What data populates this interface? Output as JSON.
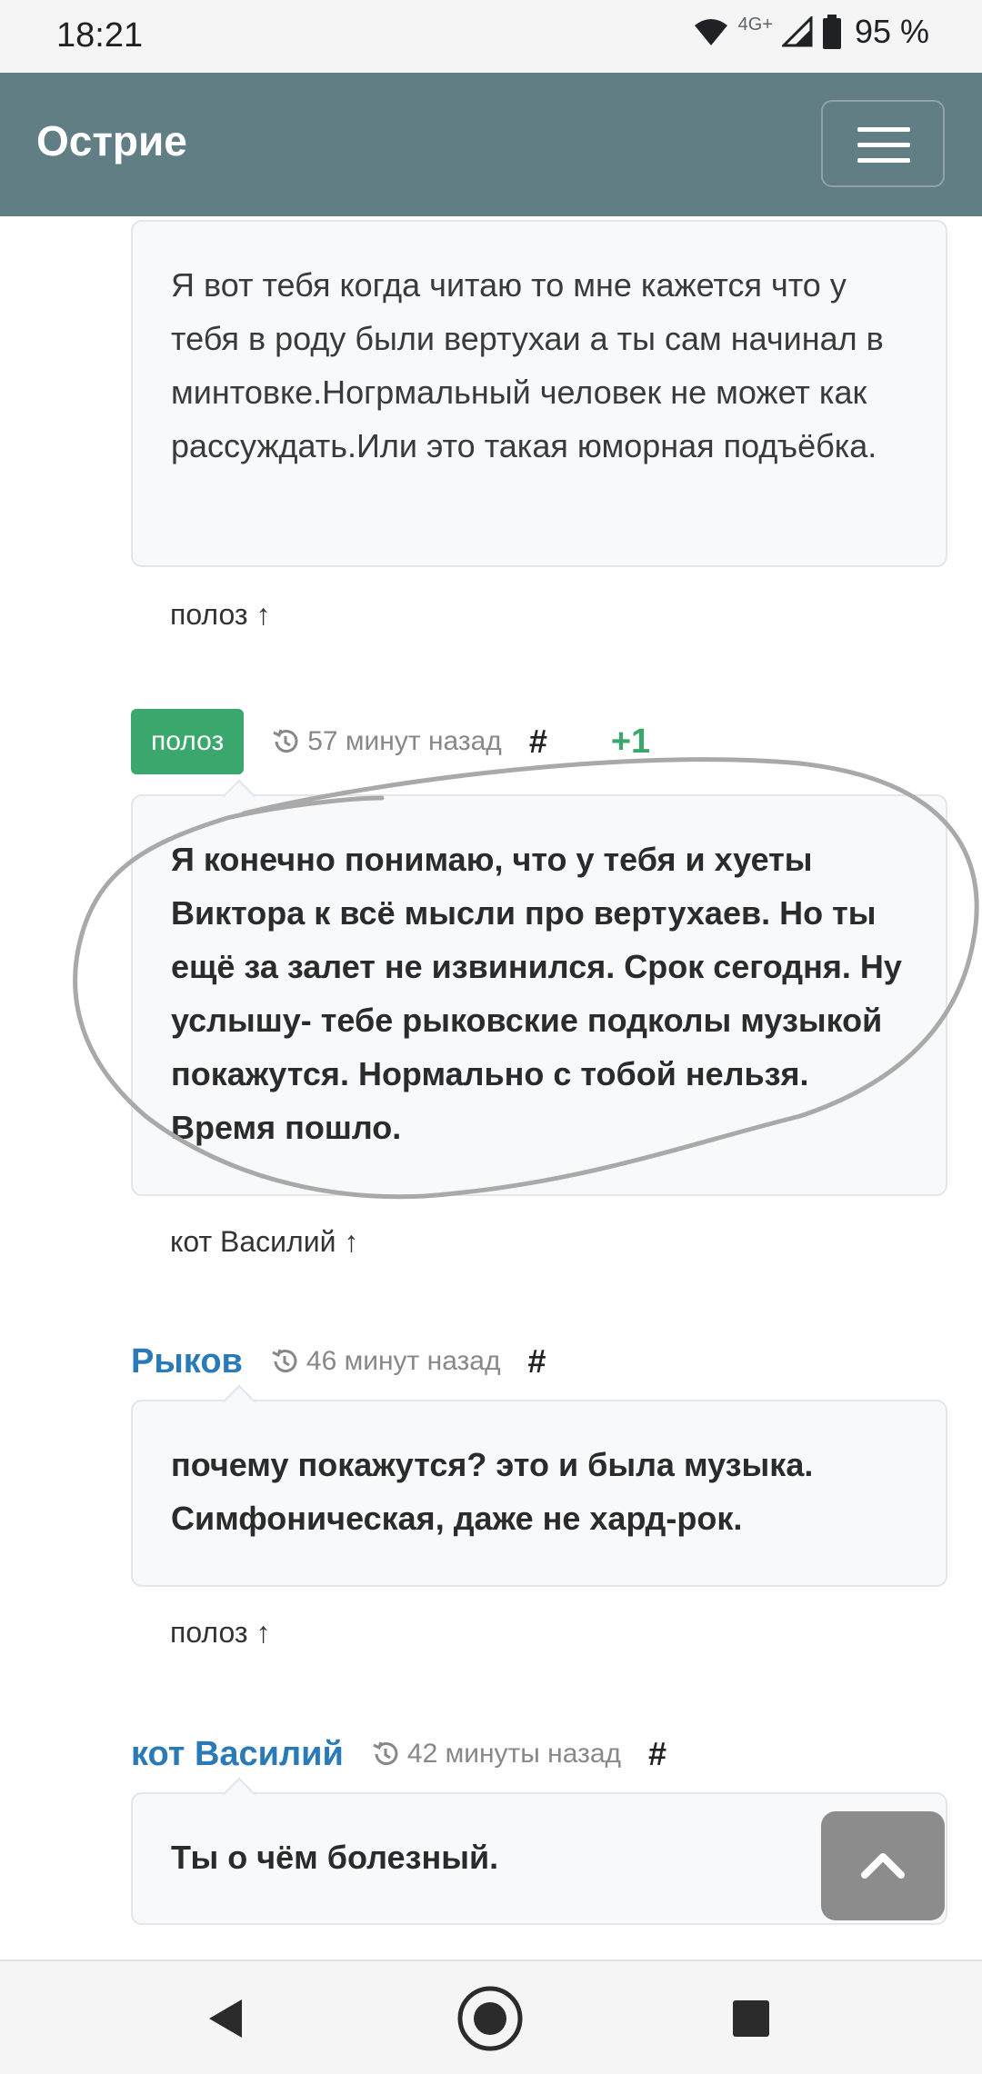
{
  "status": {
    "time": "18:21",
    "network": "4G+",
    "battery": "95 %",
    "icons": [
      "wifi-icon",
      "signal-icon",
      "battery-icon"
    ]
  },
  "navbar": {
    "brand": "Острие",
    "toggler_icon": "hamburger-icon"
  },
  "comments": [
    {
      "text": "Я вот тебя когда читаю то мне кажется что у тебя в роду были вертухаи а ты сам начинал в минтовке.Ногрмальный человек не может как рассуждать.Или это такая юморная подъёбка.",
      "reply_to": "полоз ↑"
    },
    {
      "author": "полоз",
      "time": "57 минут назад",
      "hash": "#",
      "votes": "+1",
      "text": "Я конечно понимаю, что у тебя и хуеты Виктора к всё мысли про вертухаев. Но ты ещё за залет не извинился. Срок сегодня. Ну услышу- тебе рыковские подколы музыкой покажутся. Нормально с тобой нельзя. Время пошло.",
      "reply_to": "кот Василий ↑"
    },
    {
      "author": "Рыков",
      "time": "46 минут назад",
      "hash": "#",
      "text": "почему покажутся? это и была музыка. Симфоническая, даже не хард-рок.",
      "reply_to": "полоз ↑"
    },
    {
      "author": "кот Василий",
      "time": "42 минуты назад",
      "hash": "#",
      "text": "Ты о чём болезный."
    }
  ],
  "colors": {
    "navbar": "#617e85",
    "badge_green": "#3aa76d",
    "link_blue": "#2a7ab8"
  },
  "system_nav": [
    "back-icon",
    "home-icon",
    "recents-icon"
  ]
}
